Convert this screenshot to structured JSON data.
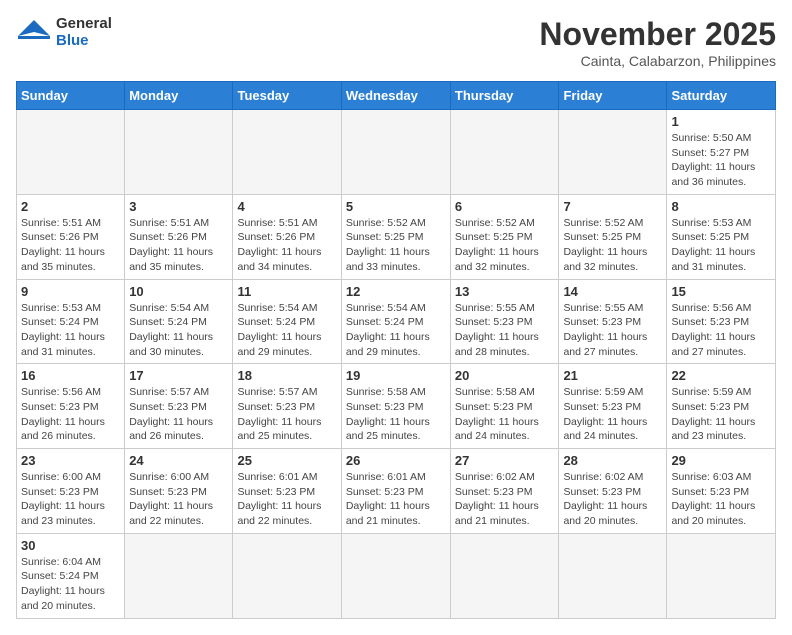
{
  "logo": {
    "line1": "General",
    "line2": "Blue"
  },
  "title": "November 2025",
  "location": "Cainta, Calabarzon, Philippines",
  "weekdays": [
    "Sunday",
    "Monday",
    "Tuesday",
    "Wednesday",
    "Thursday",
    "Friday",
    "Saturday"
  ],
  "days": {
    "1": {
      "sunrise": "5:50 AM",
      "sunset": "5:27 PM",
      "daylight": "11 hours and 36 minutes."
    },
    "2": {
      "sunrise": "5:51 AM",
      "sunset": "5:26 PM",
      "daylight": "11 hours and 35 minutes."
    },
    "3": {
      "sunrise": "5:51 AM",
      "sunset": "5:26 PM",
      "daylight": "11 hours and 35 minutes."
    },
    "4": {
      "sunrise": "5:51 AM",
      "sunset": "5:26 PM",
      "daylight": "11 hours and 34 minutes."
    },
    "5": {
      "sunrise": "5:52 AM",
      "sunset": "5:25 PM",
      "daylight": "11 hours and 33 minutes."
    },
    "6": {
      "sunrise": "5:52 AM",
      "sunset": "5:25 PM",
      "daylight": "11 hours and 32 minutes."
    },
    "7": {
      "sunrise": "5:52 AM",
      "sunset": "5:25 PM",
      "daylight": "11 hours and 32 minutes."
    },
    "8": {
      "sunrise": "5:53 AM",
      "sunset": "5:25 PM",
      "daylight": "11 hours and 31 minutes."
    },
    "9": {
      "sunrise": "5:53 AM",
      "sunset": "5:24 PM",
      "daylight": "11 hours and 31 minutes."
    },
    "10": {
      "sunrise": "5:54 AM",
      "sunset": "5:24 PM",
      "daylight": "11 hours and 30 minutes."
    },
    "11": {
      "sunrise": "5:54 AM",
      "sunset": "5:24 PM",
      "daylight": "11 hours and 29 minutes."
    },
    "12": {
      "sunrise": "5:54 AM",
      "sunset": "5:24 PM",
      "daylight": "11 hours and 29 minutes."
    },
    "13": {
      "sunrise": "5:55 AM",
      "sunset": "5:23 PM",
      "daylight": "11 hours and 28 minutes."
    },
    "14": {
      "sunrise": "5:55 AM",
      "sunset": "5:23 PM",
      "daylight": "11 hours and 27 minutes."
    },
    "15": {
      "sunrise": "5:56 AM",
      "sunset": "5:23 PM",
      "daylight": "11 hours and 27 minutes."
    },
    "16": {
      "sunrise": "5:56 AM",
      "sunset": "5:23 PM",
      "daylight": "11 hours and 26 minutes."
    },
    "17": {
      "sunrise": "5:57 AM",
      "sunset": "5:23 PM",
      "daylight": "11 hours and 26 minutes."
    },
    "18": {
      "sunrise": "5:57 AM",
      "sunset": "5:23 PM",
      "daylight": "11 hours and 25 minutes."
    },
    "19": {
      "sunrise": "5:58 AM",
      "sunset": "5:23 PM",
      "daylight": "11 hours and 25 minutes."
    },
    "20": {
      "sunrise": "5:58 AM",
      "sunset": "5:23 PM",
      "daylight": "11 hours and 24 minutes."
    },
    "21": {
      "sunrise": "5:59 AM",
      "sunset": "5:23 PM",
      "daylight": "11 hours and 24 minutes."
    },
    "22": {
      "sunrise": "5:59 AM",
      "sunset": "5:23 PM",
      "daylight": "11 hours and 23 minutes."
    },
    "23": {
      "sunrise": "6:00 AM",
      "sunset": "5:23 PM",
      "daylight": "11 hours and 23 minutes."
    },
    "24": {
      "sunrise": "6:00 AM",
      "sunset": "5:23 PM",
      "daylight": "11 hours and 22 minutes."
    },
    "25": {
      "sunrise": "6:01 AM",
      "sunset": "5:23 PM",
      "daylight": "11 hours and 22 minutes."
    },
    "26": {
      "sunrise": "6:01 AM",
      "sunset": "5:23 PM",
      "daylight": "11 hours and 21 minutes."
    },
    "27": {
      "sunrise": "6:02 AM",
      "sunset": "5:23 PM",
      "daylight": "11 hours and 21 minutes."
    },
    "28": {
      "sunrise": "6:02 AM",
      "sunset": "5:23 PM",
      "daylight": "11 hours and 20 minutes."
    },
    "29": {
      "sunrise": "6:03 AM",
      "sunset": "5:23 PM",
      "daylight": "11 hours and 20 minutes."
    },
    "30": {
      "sunrise": "6:04 AM",
      "sunset": "5:24 PM",
      "daylight": "11 hours and 20 minutes."
    }
  },
  "labels": {
    "sunrise": "Sunrise:",
    "sunset": "Sunset:",
    "daylight": "Daylight:"
  }
}
